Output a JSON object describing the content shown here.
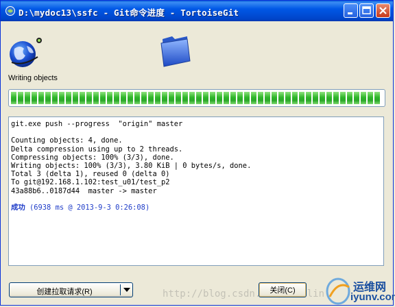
{
  "window": {
    "title": "D:\\mydoc13\\ssfc - Git命令进度 - TortoiseGit"
  },
  "icons": {
    "app": "tortoisegit-icon",
    "globe": "globe-network-icon",
    "folder": "folder-icon"
  },
  "status": {
    "label": "Writing objects",
    "progress_percent": 100
  },
  "log": {
    "lines": [
      "git.exe push --progress  \"origin\" master",
      "",
      "Counting objects: 4, done.",
      "Delta compression using up to 2 threads.",
      "Compressing objects: 100% (3/3), done.",
      "Writing objects: 100% (3/3), 3.80 KiB | 0 bytes/s, done.",
      "Total 3 (delta 1), reused 0 (delta 0)",
      "To git@192.168.1.102:test_u01/test_p2",
      "43a88b6..0187d44  master -> master",
      ""
    ],
    "success_word": "成功",
    "success_detail": " (6938 ms @ 2013-9-3 0:26:08)"
  },
  "buttons": {
    "pull_request": "创建拉取请求(R)",
    "close": "关闭(C)"
  },
  "watermark": "http://blog.csdn.net/  baolin",
  "logo": {
    "line1": "运维网",
    "line2": "iyunv.com"
  },
  "colors": {
    "titlebar": "#0054e3",
    "progress": "#2fb62a",
    "success_text": "#1e3cc8"
  }
}
